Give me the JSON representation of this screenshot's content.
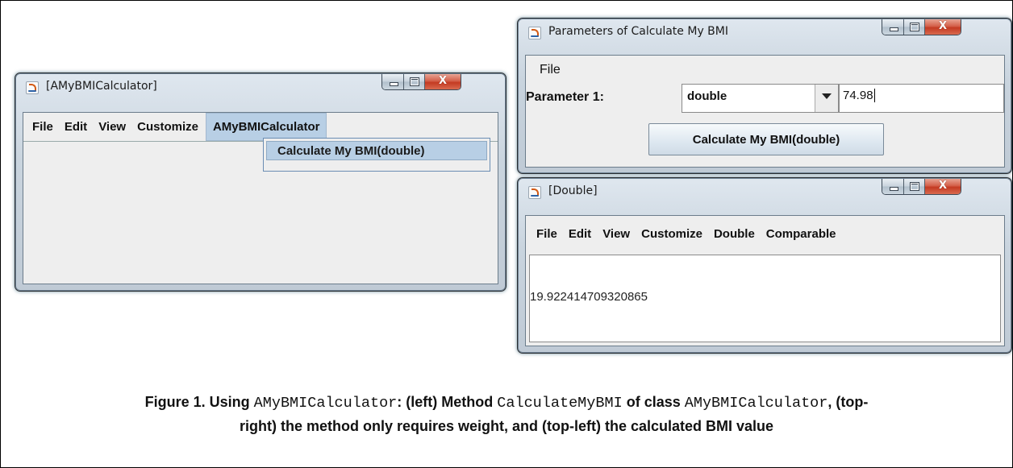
{
  "left_window": {
    "title": "[AMyBMICalculator]",
    "menu": [
      "File",
      "Edit",
      "View",
      "Customize",
      "AMyBMICalculator"
    ],
    "active_menu": "AMyBMICalculator",
    "popup_item": "Calculate My BMI(double)"
  },
  "params_window": {
    "title": "Parameters of Calculate My BMI",
    "menu": [
      "File"
    ],
    "param_label": "Parameter 1:",
    "type_selected": "double",
    "value": "74.98",
    "button_label": "Calculate My BMI(double)"
  },
  "result_window": {
    "title": "[Double]",
    "menu": [
      "File",
      "Edit",
      "View",
      "Customize",
      "Double",
      "Comparable"
    ],
    "result_value": "19.922414709320865"
  },
  "caption": {
    "line1_bold_a": "Figure 1. Using ",
    "line1_mono_a": "AMyBMICalculator",
    "line1_bold_b": ": (left) Method ",
    "line1_mono_b": "CalculateMyBMI",
    "line1_bold_c": " of class ",
    "line1_mono_c": "AMyBMICalculator",
    "line1_bold_d": ", (top-",
    "line2": "right) the method only requires weight, and (top-left) the calculated BMI value"
  }
}
